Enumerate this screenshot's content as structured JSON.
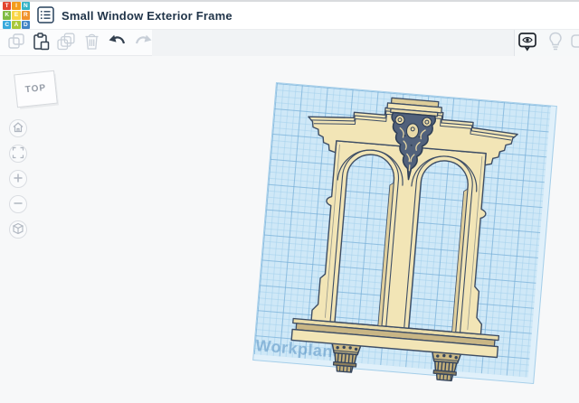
{
  "header": {
    "logo": {
      "letters": [
        "T",
        "I",
        "N",
        "K",
        "E",
        "R",
        "C",
        "A",
        "D"
      ],
      "colors": [
        "#E2452F",
        "#F49C1C",
        "#35B3C6",
        "#7FBC42",
        "#F8D544",
        "#F0922B",
        "#38A9DC",
        "#A9C83B",
        "#4183C4"
      ]
    },
    "title": "Small Window Exterior Frame"
  },
  "toolbar": {
    "edit_buttons": [
      {
        "name": "copy",
        "icon": "copy-icon",
        "enabled": false
      },
      {
        "name": "paste",
        "icon": "paste-icon",
        "enabled": true
      },
      {
        "name": "duplicate",
        "icon": "duplicate-icon",
        "enabled": false
      },
      {
        "name": "delete",
        "icon": "trash-icon",
        "enabled": false
      },
      {
        "name": "undo",
        "icon": "undo-arrow-icon",
        "enabled": true
      },
      {
        "name": "redo",
        "icon": "redo-arrow-icon",
        "enabled": false
      }
    ],
    "view_buttons": [
      {
        "name": "hide-selected",
        "icon": "eye-bubble-icon",
        "enabled": true
      },
      {
        "name": "show-all",
        "icon": "lightbulb-icon",
        "enabled": false
      },
      {
        "name": "edge-cutoff",
        "icon": "cut-off-icon",
        "enabled": false
      }
    ]
  },
  "viewport": {
    "viewcube": {
      "label": "TOP"
    },
    "nav_buttons": [
      "home-view",
      "fit-view",
      "zoom-in",
      "zoom-out",
      "perspective-toggle"
    ],
    "workplane": {
      "label": "Workplane",
      "grid_color": "#CFE8F7",
      "major_line_color": "#74ACD6",
      "minor_line_color": "#A4D0EC"
    },
    "model": {
      "description": "Ornate two-arch window exterior frame with stepped pediment, carved cartouche, sill and corbels",
      "body_color": "#F2E5B6",
      "outline_color": "#3D4D65",
      "shade_color": "#C9B685",
      "carving_color": "#51617B"
    }
  }
}
